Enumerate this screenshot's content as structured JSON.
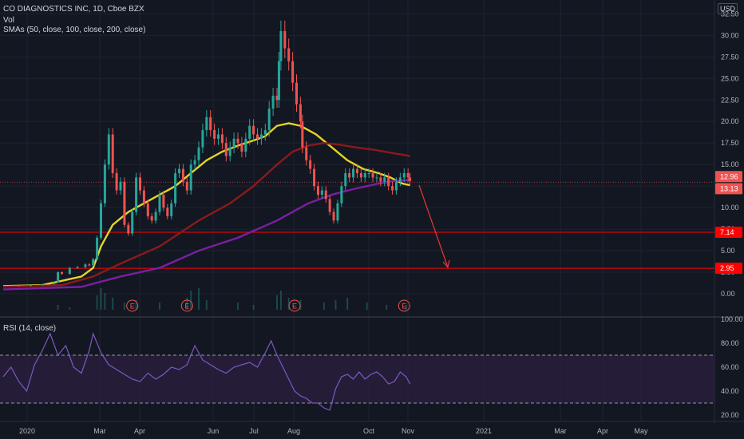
{
  "header": {
    "title": "CO DIAGNOSTICS INC, 1D, Cboe BZX",
    "vol_label": "Vol",
    "sma_label": "SMAs (50, close, 100, close, 200, close)",
    "currency": "USD"
  },
  "rsi": {
    "label": "RSI (14, close)",
    "ticks": [
      "100.00",
      "80.00",
      "60.00",
      "40.00",
      "20.00"
    ],
    "upper_band": 70,
    "lower_band": 30,
    "series": [
      [
        0,
        52
      ],
      [
        4,
        60
      ],
      [
        8,
        48
      ],
      [
        12,
        40
      ],
      [
        16,
        62
      ],
      [
        20,
        74
      ],
      [
        24,
        88
      ],
      [
        28,
        70
      ],
      [
        32,
        78
      ],
      [
        36,
        60
      ],
      [
        40,
        55
      ],
      [
        44,
        74
      ],
      [
        46,
        88
      ],
      [
        50,
        72
      ],
      [
        54,
        62
      ],
      [
        58,
        58
      ],
      [
        62,
        54
      ],
      [
        66,
        50
      ],
      [
        70,
        48
      ],
      [
        74,
        55
      ],
      [
        78,
        50
      ],
      [
        82,
        54
      ],
      [
        86,
        60
      ],
      [
        90,
        58
      ],
      [
        94,
        62
      ],
      [
        98,
        78
      ],
      [
        102,
        66
      ],
      [
        106,
        62
      ],
      [
        110,
        58
      ],
      [
        114,
        55
      ],
      [
        118,
        60
      ],
      [
        122,
        62
      ],
      [
        126,
        64
      ],
      [
        130,
        60
      ],
      [
        134,
        72
      ],
      [
        137,
        82
      ],
      [
        140,
        70
      ],
      [
        143,
        60
      ],
      [
        146,
        50
      ],
      [
        149,
        40
      ],
      [
        152,
        36
      ],
      [
        155,
        34
      ],
      [
        158,
        30
      ],
      [
        161,
        30
      ],
      [
        164,
        26
      ],
      [
        167,
        24
      ],
      [
        170,
        42
      ],
      [
        173,
        52
      ],
      [
        176,
        54
      ],
      [
        179,
        50
      ],
      [
        182,
        56
      ],
      [
        185,
        50
      ],
      [
        188,
        54
      ],
      [
        191,
        56
      ],
      [
        194,
        52
      ],
      [
        197,
        46
      ],
      [
        200,
        48
      ],
      [
        203,
        56
      ],
      [
        206,
        52
      ],
      [
        208,
        46
      ]
    ]
  },
  "price_axis": {
    "ticks": [
      "32.50",
      "30.00",
      "27.50",
      "25.00",
      "22.50",
      "20.00",
      "17.50",
      "15.00",
      "12.50",
      "10.00",
      "7.50",
      "5.00",
      "2.50",
      "0.00"
    ],
    "current_labels": [
      "12.96",
      "13.13"
    ],
    "level_labels": [
      "7.14",
      "2.95"
    ]
  },
  "time_axis": {
    "labels": [
      "2020",
      "Mar",
      "Apr",
      "Jun",
      "Jul",
      "Aug",
      "Oct",
      "Nov",
      "2021",
      "Mar",
      "Apr",
      "May"
    ]
  },
  "earnings": {
    "marker": "E"
  },
  "colors": {
    "background": "#131722",
    "grid": "#1f2330",
    "up": "#26a69a",
    "down": "#ef5350",
    "sma50": "#e6d327",
    "sma100": "#8b1a1a",
    "sma200": "#7b1fa2",
    "level_line": "#ff0000",
    "rsi_line": "#7e57c2",
    "rsi_band_fill": "#2a1f3f",
    "arrow": "#e53935"
  },
  "chart_data": {
    "type": "line",
    "title": "CO DIAGNOSTICS INC, 1D, Cboe BZX",
    "ylim": [
      0,
      33
    ],
    "x_labels": [
      "2020",
      "Mar",
      "Apr",
      "Jun",
      "Jul",
      "Aug",
      "Oct",
      "Nov",
      "2021",
      "Mar",
      "Apr",
      "May"
    ],
    "horizontal_levels": [
      7.14,
      2.95
    ],
    "last_price": 12.96,
    "series": [
      {
        "name": "close",
        "values": [
          [
            0,
            1.0
          ],
          [
            8,
            0.9
          ],
          [
            14,
            1.0
          ],
          [
            20,
            1.1
          ],
          [
            26,
            1.3
          ],
          [
            28,
            2.5
          ],
          [
            30,
            2.3
          ],
          [
            34,
            3.0
          ],
          [
            38,
            3.1
          ],
          [
            42,
            3.4
          ],
          [
            44,
            3.3
          ],
          [
            46,
            4.0
          ],
          [
            48,
            6.5
          ],
          [
            50,
            10.5
          ],
          [
            52,
            15.0
          ],
          [
            54,
            18.5
          ],
          [
            56,
            14.0
          ],
          [
            58,
            12.0
          ],
          [
            60,
            13.0
          ],
          [
            62,
            8.0
          ],
          [
            64,
            7.0
          ],
          [
            66,
            9.5
          ],
          [
            68,
            13.5
          ],
          [
            70,
            12.0
          ],
          [
            72,
            10.5
          ],
          [
            74,
            9.0
          ],
          [
            76,
            8.5
          ],
          [
            78,
            9.5
          ],
          [
            80,
            11.5
          ],
          [
            82,
            10.0
          ],
          [
            84,
            9.0
          ],
          [
            86,
            10.5
          ],
          [
            88,
            14.0
          ],
          [
            90,
            14.5
          ],
          [
            92,
            13.0
          ],
          [
            94,
            12.0
          ],
          [
            96,
            15.0
          ],
          [
            98,
            15.5
          ],
          [
            100,
            17.0
          ],
          [
            102,
            19.0
          ],
          [
            104,
            20.5
          ],
          [
            106,
            19.0
          ],
          [
            108,
            18.0
          ],
          [
            110,
            18.5
          ],
          [
            112,
            17.5
          ],
          [
            114,
            16.0
          ],
          [
            116,
            17.0
          ],
          [
            118,
            18.0
          ],
          [
            120,
            17.5
          ],
          [
            122,
            16.5
          ],
          [
            124,
            18.0
          ],
          [
            126,
            19.5
          ],
          [
            128,
            18.5
          ],
          [
            130,
            18.0
          ],
          [
            132,
            18.5
          ],
          [
            134,
            19.0
          ],
          [
            136,
            21.5
          ],
          [
            138,
            23.0
          ],
          [
            140,
            22.5
          ],
          [
            141,
            27.0
          ],
          [
            142,
            30.5
          ],
          [
            144,
            28.5
          ],
          [
            146,
            27.0
          ],
          [
            148,
            24.5
          ],
          [
            150,
            22.0
          ],
          [
            152,
            20.0
          ],
          [
            153,
            17.0
          ],
          [
            155,
            15.5
          ],
          [
            157,
            14.5
          ],
          [
            159,
            12.5
          ],
          [
            161,
            11.5
          ],
          [
            163,
            12.0
          ],
          [
            165,
            11.0
          ],
          [
            167,
            9.5
          ],
          [
            169,
            8.5
          ],
          [
            171,
            10.5
          ],
          [
            173,
            12.5
          ],
          [
            175,
            14.0
          ],
          [
            177,
            13.5
          ],
          [
            179,
            14.5
          ],
          [
            181,
            14.0
          ],
          [
            183,
            13.5
          ],
          [
            185,
            14.0
          ],
          [
            187,
            14.0
          ],
          [
            189,
            13.5
          ],
          [
            191,
            13.5
          ],
          [
            193,
            13.0
          ],
          [
            195,
            13.5
          ],
          [
            197,
            12.5
          ],
          [
            199,
            12.0
          ],
          [
            201,
            13.0
          ],
          [
            203,
            13.5
          ],
          [
            205,
            14.0
          ],
          [
            207,
            13.5
          ],
          [
            208,
            13.1
          ]
        ]
      },
      {
        "name": "SMA 50",
        "values": [
          [
            0,
            0.9
          ],
          [
            20,
            1.0
          ],
          [
            40,
            2.0
          ],
          [
            46,
            3.0
          ],
          [
            50,
            5.5
          ],
          [
            56,
            8.0
          ],
          [
            64,
            9.5
          ],
          [
            72,
            10.5
          ],
          [
            80,
            11.5
          ],
          [
            88,
            12.5
          ],
          [
            96,
            14.0
          ],
          [
            104,
            15.5
          ],
          [
            112,
            16.5
          ],
          [
            120,
            17.2
          ],
          [
            128,
            17.8
          ],
          [
            134,
            18.3
          ],
          [
            140,
            19.5
          ],
          [
            146,
            19.8
          ],
          [
            152,
            19.5
          ],
          [
            160,
            18.5
          ],
          [
            168,
            17.0
          ],
          [
            176,
            15.5
          ],
          [
            184,
            14.5
          ],
          [
            192,
            14.0
          ],
          [
            198,
            13.5
          ],
          [
            204,
            12.8
          ],
          [
            208,
            12.6
          ]
        ]
      },
      {
        "name": "SMA 100",
        "values": [
          [
            0,
            0.8
          ],
          [
            30,
            1.0
          ],
          [
            46,
            2.0
          ],
          [
            60,
            3.5
          ],
          [
            80,
            5.5
          ],
          [
            100,
            8.5
          ],
          [
            116,
            10.5
          ],
          [
            128,
            12.5
          ],
          [
            140,
            15.0
          ],
          [
            148,
            16.5
          ],
          [
            156,
            17.2
          ],
          [
            164,
            17.5
          ],
          [
            172,
            17.3
          ],
          [
            180,
            17.0
          ],
          [
            190,
            16.7
          ],
          [
            200,
            16.3
          ],
          [
            208,
            16.0
          ]
        ]
      },
      {
        "name": "SMA 200",
        "values": [
          [
            0,
            0.5
          ],
          [
            40,
            0.8
          ],
          [
            60,
            2.0
          ],
          [
            80,
            3.0
          ],
          [
            100,
            5.0
          ],
          [
            120,
            6.5
          ],
          [
            140,
            8.5
          ],
          [
            156,
            10.5
          ],
          [
            168,
            11.5
          ],
          [
            180,
            12.2
          ],
          [
            192,
            12.8
          ],
          [
            200,
            13.1
          ],
          [
            208,
            13.2
          ]
        ]
      }
    ],
    "volume": [
      [
        28,
        0.2
      ],
      [
        34,
        0.1
      ],
      [
        48,
        0.6
      ],
      [
        50,
        0.9
      ],
      [
        52,
        0.7
      ],
      [
        56,
        0.5
      ],
      [
        62,
        0.3
      ],
      [
        68,
        0.4
      ],
      [
        80,
        0.3
      ],
      [
        94,
        0.5
      ],
      [
        96,
        0.8
      ],
      [
        100,
        0.9
      ],
      [
        104,
        0.4
      ],
      [
        120,
        0.3
      ],
      [
        128,
        0.2
      ],
      [
        140,
        0.6
      ],
      [
        142,
        0.8
      ],
      [
        146,
        0.5
      ],
      [
        152,
        0.4
      ],
      [
        164,
        0.3
      ],
      [
        170,
        0.4
      ],
      [
        176,
        0.5
      ],
      [
        186,
        0.3
      ],
      [
        196,
        0.2
      ],
      [
        206,
        0.2
      ]
    ],
    "earnings_at": [
      66,
      94,
      149,
      205
    ]
  }
}
